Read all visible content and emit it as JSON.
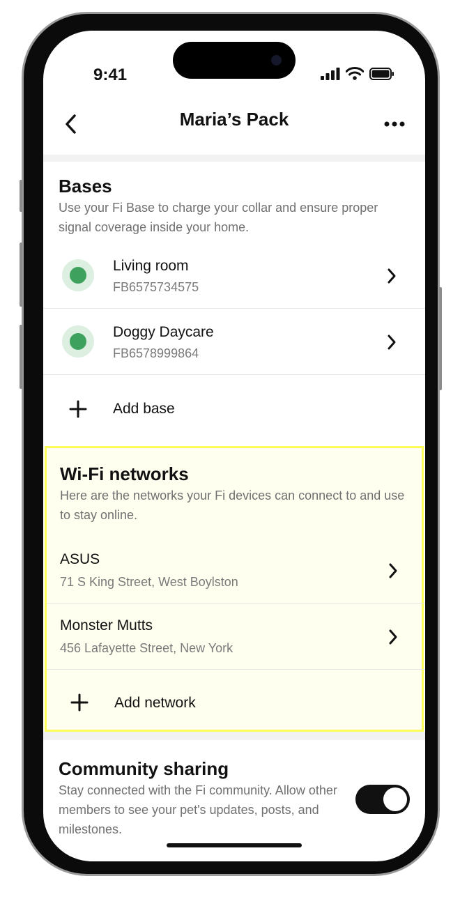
{
  "status_bar": {
    "time": "9:41"
  },
  "nav": {
    "title": "Maria’s Pack"
  },
  "bases": {
    "title": "Bases",
    "description": "Use your Fi Base to charge your collar and ensure proper signal coverage inside your home.",
    "items": [
      {
        "name": "Living room",
        "serial": "FB6575734575",
        "status_color": "#3fa15e"
      },
      {
        "name": "Doggy Daycare",
        "serial": "FB6578999864",
        "status_color": "#3fa15e"
      }
    ],
    "add_label": "Add base"
  },
  "wifi": {
    "title": "Wi-Fi networks",
    "description": "Here are the networks your Fi devices can connect to and use to stay online.",
    "items": [
      {
        "name": "ASUS",
        "address": "71 S King Street, West Boylston"
      },
      {
        "name": "Monster Mutts",
        "address": "456 Lafayette Street, New York"
      }
    ],
    "add_label": "Add network",
    "highlight_color": "#fdfd5a"
  },
  "community": {
    "title": "Community sharing",
    "description": "Stay connected with the Fi community. Allow other members to see your pet's updates, posts, and milestones.",
    "toggle_on": true
  }
}
